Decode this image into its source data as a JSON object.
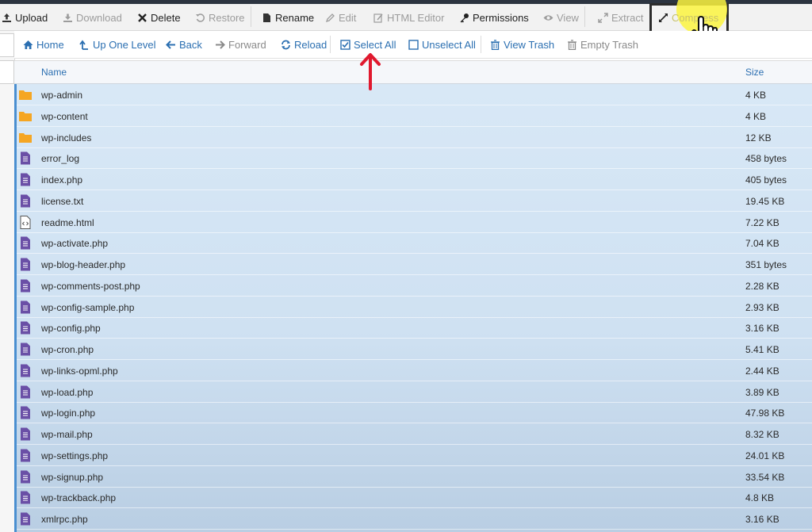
{
  "toolbar": {
    "upload": "Upload",
    "download": "Download",
    "delete": "Delete",
    "restore": "Restore",
    "rename": "Rename",
    "edit": "Edit",
    "html_editor": "HTML Editor",
    "permissions": "Permissions",
    "view": "View",
    "extract": "Extract",
    "compress": "Compress"
  },
  "nav": {
    "home": "Home",
    "up_one_level": "Up One Level",
    "back": "Back",
    "forward": "Forward",
    "reload": "Reload",
    "select_all": "Select All",
    "unselect_all": "Unselect All",
    "view_trash": "View Trash",
    "empty_trash": "Empty Trash"
  },
  "table": {
    "columns": {
      "name": "Name",
      "size": "Size"
    },
    "rows": [
      {
        "name": "wp-admin",
        "size": "4 KB",
        "type": "folder"
      },
      {
        "name": "wp-content",
        "size": "4 KB",
        "type": "folder"
      },
      {
        "name": "wp-includes",
        "size": "12 KB",
        "type": "folder"
      },
      {
        "name": "error_log",
        "size": "458 bytes",
        "type": "file"
      },
      {
        "name": "index.php",
        "size": "405 bytes",
        "type": "file"
      },
      {
        "name": "license.txt",
        "size": "19.45 KB",
        "type": "file"
      },
      {
        "name": "readme.html",
        "size": "7.22 KB",
        "type": "html"
      },
      {
        "name": "wp-activate.php",
        "size": "7.04 KB",
        "type": "file"
      },
      {
        "name": "wp-blog-header.php",
        "size": "351 bytes",
        "type": "file"
      },
      {
        "name": "wp-comments-post.php",
        "size": "2.28 KB",
        "type": "file"
      },
      {
        "name": "wp-config-sample.php",
        "size": "2.93 KB",
        "type": "file"
      },
      {
        "name": "wp-config.php",
        "size": "3.16 KB",
        "type": "file"
      },
      {
        "name": "wp-cron.php",
        "size": "5.41 KB",
        "type": "file"
      },
      {
        "name": "wp-links-opml.php",
        "size": "2.44 KB",
        "type": "file"
      },
      {
        "name": "wp-load.php",
        "size": "3.89 KB",
        "type": "file"
      },
      {
        "name": "wp-login.php",
        "size": "47.98 KB",
        "type": "file"
      },
      {
        "name": "wp-mail.php",
        "size": "8.32 KB",
        "type": "file"
      },
      {
        "name": "wp-settings.php",
        "size": "24.01 KB",
        "type": "file"
      },
      {
        "name": "wp-signup.php",
        "size": "33.54 KB",
        "type": "file"
      },
      {
        "name": "wp-trackback.php",
        "size": "4.8 KB",
        "type": "file"
      },
      {
        "name": "xmlrpc.php",
        "size": "3.16 KB",
        "type": "file"
      }
    ]
  },
  "colors": {
    "accent": "#2b6fb1",
    "folder": "#f5a623",
    "file": "#6a4fa6",
    "selection": "#d8e8f6",
    "annotation_arrow": "#e0192e",
    "highlight": "#fcf440"
  },
  "icons": {
    "folder": "folder-icon",
    "file": "file-icon",
    "html": "html-file-icon"
  }
}
